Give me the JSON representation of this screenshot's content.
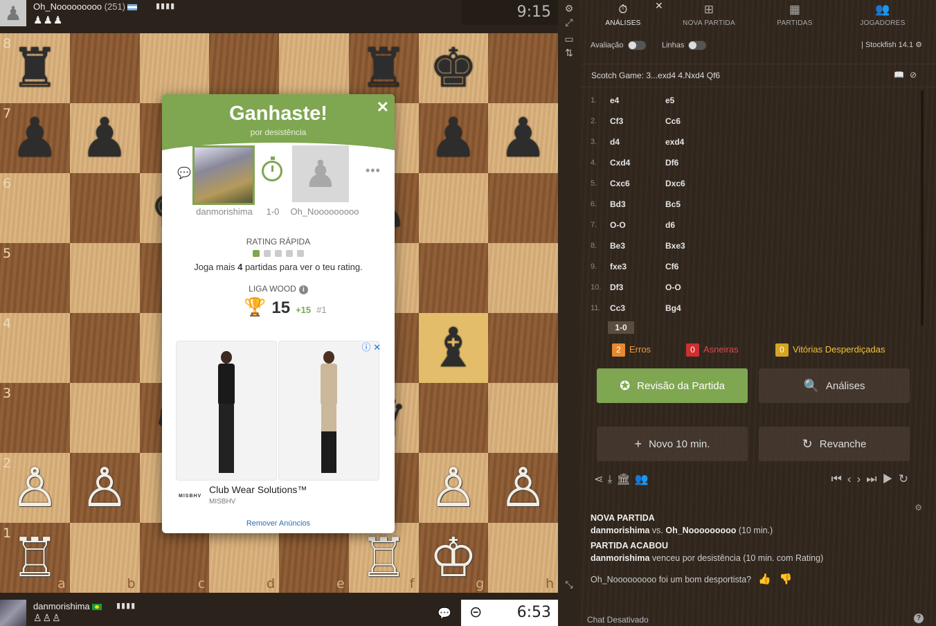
{
  "top_player": {
    "name": "Oh_Nooooooooo",
    "rating": "(251)",
    "captured": "♟♟♟",
    "clock": "9:15"
  },
  "bottom_player": {
    "name": "danmorishima",
    "captured": "♙♙♙",
    "clock": "6:53"
  },
  "board": {
    "ranks": [
      "8",
      "7",
      "6",
      "5",
      "4",
      "3",
      "2",
      "1"
    ],
    "files": [
      "a",
      "b",
      "c",
      "d",
      "e",
      "f",
      "g",
      "h"
    ],
    "pieces": {
      "a8": "♜",
      "f8": "♜",
      "g8": "♚",
      "a7": "♟",
      "b7": "♟",
      "g7": "♟",
      "h7": "♟",
      "c6": "♚",
      "f6": "♟",
      "g4": "♝",
      "c3": "♞",
      "f3": "♛",
      "a2": "♙",
      "b2": "♙",
      "g2": "♙",
      "h2": "♙",
      "a1": "♖",
      "f1": "♖",
      "g1": "♔"
    }
  },
  "modal": {
    "title": "Ganhaste!",
    "subtitle": "por desistência",
    "winner": "danmorishima",
    "score": "1-0",
    "loser": "Oh_Nooooooooo",
    "rating_label": "RATING RÁPIDA",
    "rating_msg_pre": "Joga mais ",
    "rating_msg_num": "4",
    "rating_msg_post": " partidas para ver o teu rating.",
    "league_label": "LIGA WOOD",
    "league_points": "15",
    "league_delta": "+15",
    "league_rank": "#1",
    "ad_title": "Club Wear Solutions™",
    "ad_brand": "MISBHV",
    "ad_logo": "MISBHV",
    "remove_ads": "Remover Anúncios"
  },
  "sidebar": {
    "tabs": [
      {
        "label": "ANÁLISES",
        "icon": "stopwatch-icon"
      },
      {
        "label": "NOVA PARTIDA",
        "icon": "plus-square-icon"
      },
      {
        "label": "PARTIDAS",
        "icon": "board-icon"
      },
      {
        "label": "JOGADORES",
        "icon": "users-icon"
      }
    ],
    "opt_eval": "Avaliação",
    "opt_lines": "Linhas",
    "engine": "Stockfish 14.1",
    "opening": "Scotch Game: 3...exd4 4.Nxd4 Qf6",
    "moves": [
      {
        "n": "1.",
        "w": "e4",
        "b": "e5"
      },
      {
        "n": "2.",
        "w": "Cf3",
        "b": "Cc6"
      },
      {
        "n": "3.",
        "w": "d4",
        "b": "exd4"
      },
      {
        "n": "4.",
        "w": "Cxd4",
        "b": "Df6"
      },
      {
        "n": "5.",
        "w": "Cxc6",
        "b": "Dxc6"
      },
      {
        "n": "6.",
        "w": "Bd3",
        "b": "Bc5"
      },
      {
        "n": "7.",
        "w": "O-O",
        "b": "d6"
      },
      {
        "n": "8.",
        "w": "Be3",
        "b": "Bxe3"
      },
      {
        "n": "9.",
        "w": "fxe3",
        "b": "Cf6"
      },
      {
        "n": "10.",
        "w": "Df3",
        "b": "O-O"
      },
      {
        "n": "11.",
        "w": "Cc3",
        "b": "Bg4"
      }
    ],
    "result": "1-0",
    "stats": {
      "errors_count": "2",
      "errors_label": "Erros",
      "blunders_count": "0",
      "blunders_label": "Asneiras",
      "missed_count": "0",
      "missed_label": "Vitórias Desperdiçadas"
    },
    "buttons": {
      "review": "Revisão da Partida",
      "analyses": "Análises",
      "new_game": "Novo 10 min.",
      "rematch": "Revanche"
    },
    "chat": {
      "h1": "NOVA PARTIDA",
      "l1_a": "danmorishima",
      "l1_b": " vs. ",
      "l1_c": "Oh_Nooooooooo",
      "l1_d": " (10 min.)",
      "h2": "PARTIDA ACABOU",
      "l2_a": "danmorishima",
      "l2_b": " venceu por desistência (10 min. com Rating)",
      "l3": "Oh_Nooooooooo foi um bom desportista?",
      "disabled": "Chat Desativado"
    }
  }
}
